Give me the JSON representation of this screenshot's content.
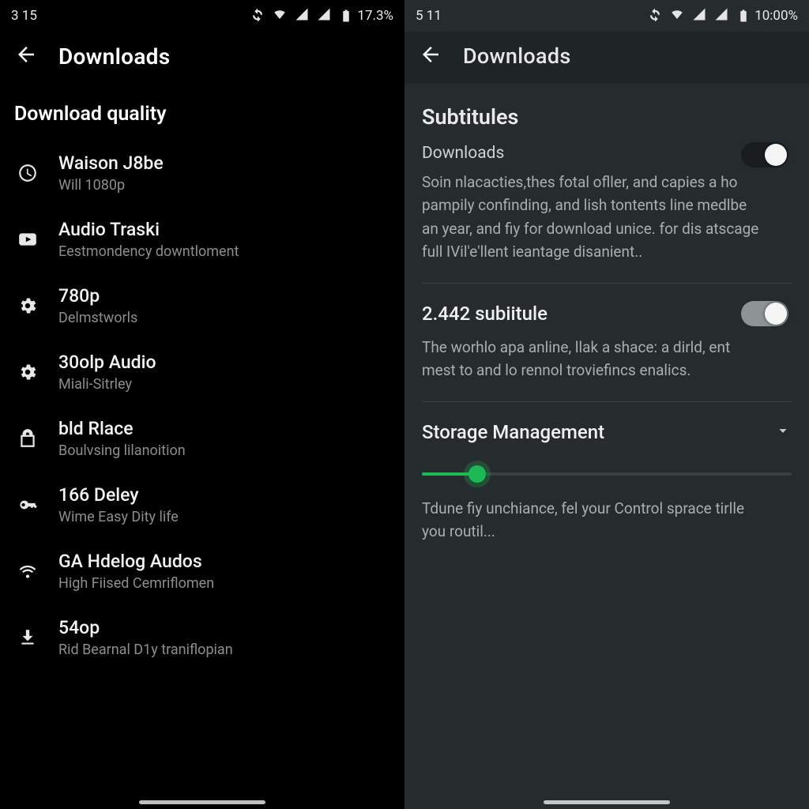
{
  "left": {
    "status": {
      "time": "3 15",
      "battery": "17.3%"
    },
    "header_title": "Downloads",
    "section_title": "Download quality",
    "items": [
      {
        "icon": "clock-icon",
        "title": "Waison J8be",
        "sub": "Will 1080p"
      },
      {
        "icon": "play-icon",
        "title": "Audio Traski",
        "sub": "Eestmondency downtloment"
      },
      {
        "icon": "gear-icon",
        "title": "780p",
        "sub": "Delmstworls"
      },
      {
        "icon": "gear-icon",
        "title": "30olp Audio",
        "sub": "Miali-Sitrley"
      },
      {
        "icon": "lock-icon",
        "title": "bld Rlace",
        "sub": "Boulvsing lilanoition"
      },
      {
        "icon": "key-icon",
        "title": "166 Deley",
        "sub": "Wime Easy Dity life"
      },
      {
        "icon": "wifi-icon",
        "title": "GA Hdelog Audos",
        "sub": "High Fiised Cemriflomen"
      },
      {
        "icon": "download-icon",
        "title": "54op",
        "sub": "Rid Bearnal D1y traniflopian"
      }
    ]
  },
  "right": {
    "status": {
      "time": "5 11",
      "battery": "10:00%"
    },
    "header_title": "Downloads",
    "section_title": "Subtitules",
    "block1": {
      "label": "Downloads",
      "toggle": true,
      "desc": "Soin nlacacties,thes fotal ofller, and capies a ho pampily confinding, and lish tontents line medlbe an year, and fiy for download unice. for dis atscage full IVil'e'llent ieantage disanient.."
    },
    "block2": {
      "label": "2.442 subiitule",
      "toggle": true,
      "desc": "The worhlo apa anline, llak a shace: a dirld, ent mest to and lo rennol troviefincs enalics."
    },
    "storage": {
      "title": "Storage Management",
      "slider_pct": 15,
      "desc": "Tdune fiy unchiance, fel your Control sprace tirlle you routil..."
    }
  }
}
